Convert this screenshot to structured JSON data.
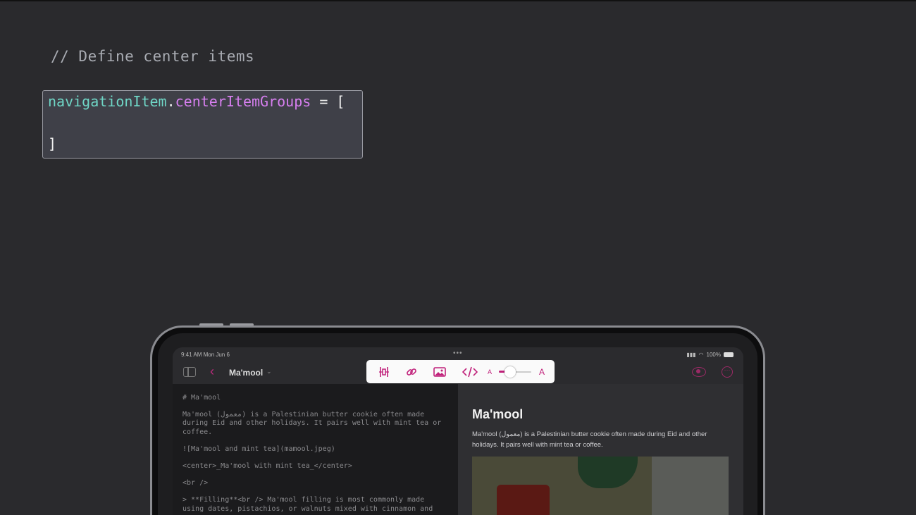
{
  "slide": {
    "comment": "// Define center items",
    "code": {
      "prop": "navigationItem",
      "dot": ".",
      "member": "centerItemGroups",
      "op": " = [",
      "close": "]"
    },
    "colors": {
      "background": "#2a2a2d",
      "prop": "#6fd6c6",
      "member": "#d77ff0"
    }
  },
  "ipad": {
    "status": {
      "time": "9:41 AM  Mon Jun 6",
      "dots": "•••",
      "battery": "100%"
    },
    "navbar": {
      "title": "Ma'mool",
      "back": "‹",
      "chevron": "⌄",
      "more": "···"
    },
    "toolbar": {
      "icons": [
        "text-indent-icon",
        "link-icon",
        "image-icon",
        "code-icon"
      ],
      "small_a": "A",
      "big_a": "A",
      "slider_value": 0.35,
      "accent": "#c0207a"
    },
    "editor": {
      "lines": [
        "# Ma'mool",
        "Ma'mool (معمول) is a Palestinian butter cookie often made during Eid and other holidays. It pairs well with mint tea or coffee.",
        "![Ma'mool and mint tea](mamool.jpeg)",
        "<center>_Ma'mool with mint tea_</center>",
        "<br />",
        "> **Filling**<br /> Ma'mool filling is most commonly made using dates, pistachios, or walnuts mixed with cinnamon and"
      ]
    },
    "preview": {
      "title": "Ma'mool",
      "text": "Ma'mool (معمول) is a Palestinian butter cookie often made during Eid and other holidays. It pairs well with mint tea or coffee."
    }
  }
}
